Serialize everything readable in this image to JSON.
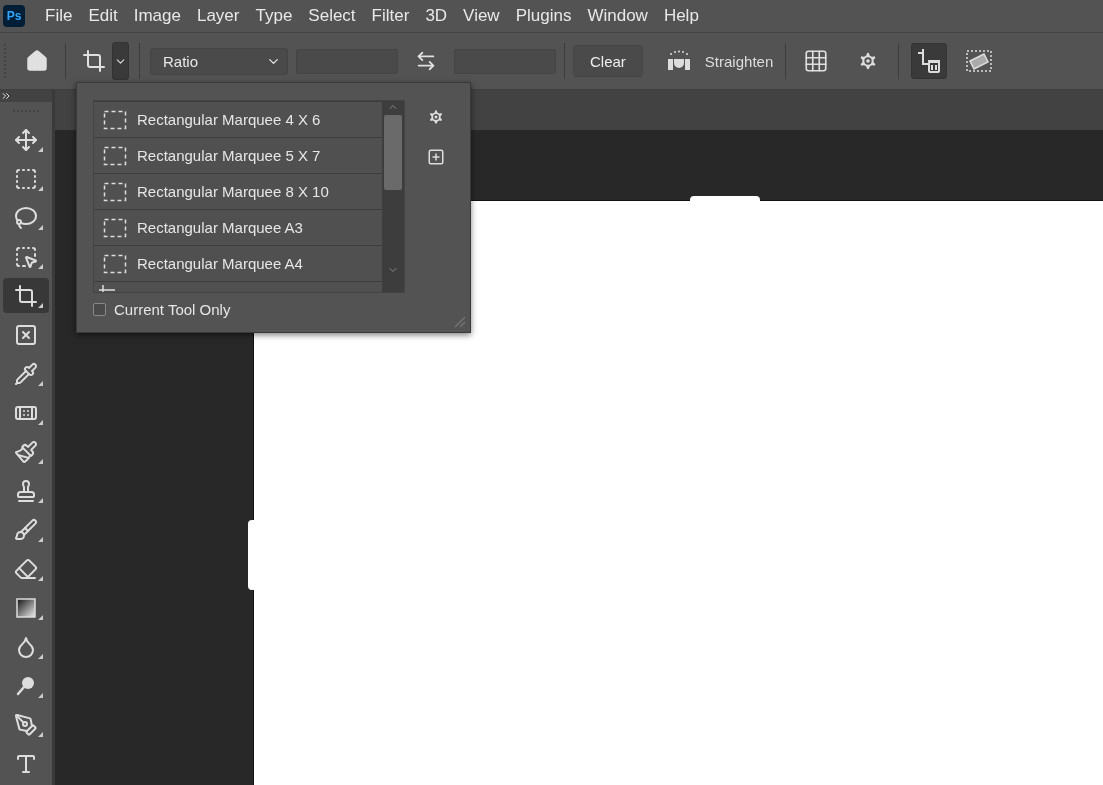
{
  "app": {
    "logo": "Ps"
  },
  "menu": [
    "File",
    "Edit",
    "Image",
    "Layer",
    "Type",
    "Select",
    "Filter",
    "3D",
    "View",
    "Plugins",
    "Window",
    "Help"
  ],
  "options_bar": {
    "tool_preset_expanded": true,
    "ratio_select": {
      "value": "Ratio"
    },
    "clear_button": "Clear",
    "straighten_label": "Straighten",
    "delete_cropped_pixels": {
      "on": true
    }
  },
  "tools": [
    {
      "selected": false
    },
    {
      "selected": false
    },
    {
      "selected": false
    },
    {
      "selected": false
    },
    {
      "selected": true
    },
    {
      "selected": false
    },
    {
      "selected": false
    },
    {
      "selected": false
    },
    {
      "selected": false
    },
    {
      "selected": false
    },
    {
      "selected": false
    },
    {
      "selected": false
    },
    {
      "selected": false
    },
    {
      "selected": false
    },
    {
      "selected": false
    },
    {
      "selected": false
    },
    {
      "selected": false
    }
  ],
  "preset_popup": {
    "presets": [
      {
        "label": "Rectangular Marquee 4 X 6"
      },
      {
        "label": "Rectangular Marquee 5 X 7"
      },
      {
        "label": "Rectangular Marquee 8 X 10"
      },
      {
        "label": "Rectangular Marquee A3"
      },
      {
        "label": "Rectangular Marquee A4"
      }
    ],
    "current_tool_only": {
      "label": "Current Tool Only",
      "checked": false
    }
  }
}
